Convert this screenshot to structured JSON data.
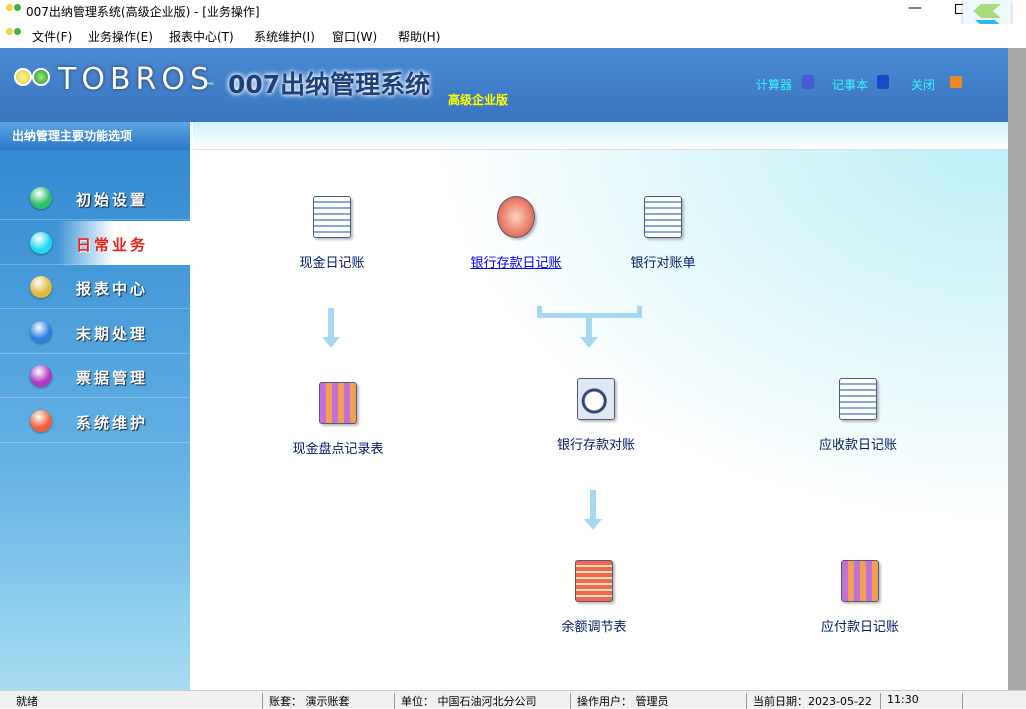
{
  "window": {
    "title": "007出纳管理系统(高级企业版) - [业务操作]"
  },
  "menu": [
    "文件(F)",
    "业务操作(E)",
    "报表中心(T)",
    "系统维护(I)",
    "窗口(W)",
    "帮助(H)"
  ],
  "header": {
    "brand": "TOBROS",
    "product": "007出纳管理系统",
    "edition": "高级企业版",
    "links": [
      {
        "label": "计算器",
        "icon": "calculator-icon"
      },
      {
        "label": "记事本",
        "icon": "notepad-icon"
      },
      {
        "label": "关闭",
        "icon": "power-icon"
      }
    ]
  },
  "sidebar": {
    "title": "出纳管理主要功能选项",
    "items": [
      {
        "label": "初始设置",
        "color": "#2fbf6a"
      },
      {
        "label": "日常业务",
        "color": "#22d8ef",
        "active": true
      },
      {
        "label": "报表中心",
        "color": "#e0b640"
      },
      {
        "label": "末期处理",
        "color": "#2c7fe0"
      },
      {
        "label": "票据管理",
        "color": "#b03ac0"
      },
      {
        "label": "系统维护",
        "color": "#f0603a"
      }
    ]
  },
  "functions": {
    "cash_journal": "现金日记账",
    "bank_journal": "银行存款日记账",
    "bank_statement": "银行对账单",
    "cash_count": "现金盘点记录表",
    "bank_reconcile": "银行存款对账",
    "receivable": "应收款日记账",
    "balance_adjust": "余额调节表",
    "payable": "应付款日记账"
  },
  "status": {
    "ready": "就绪",
    "account": "账套： 演示账套",
    "unit": "单位： 中国石油河北分公司",
    "user": "操作用户： 管理员",
    "date": "当前日期：2023-05-22",
    "time": "11:30"
  }
}
